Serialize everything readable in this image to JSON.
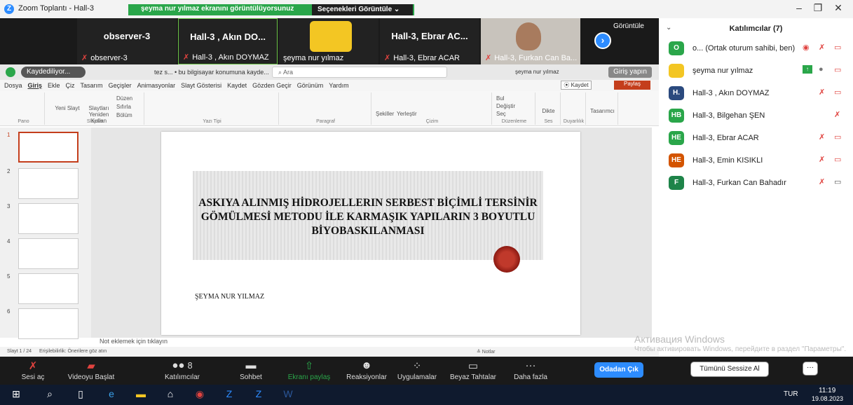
{
  "window": {
    "title": "Zoom Toplantı - Hall-3",
    "minimize": "–",
    "maximize": "❐",
    "close": "✕"
  },
  "share_banner": {
    "message": "şeyma nur yılmaz ekranını görüntülüyorsunuz",
    "options": "Seçenekleri Görüntüle  ⌄"
  },
  "strip": {
    "view_label": "Görüntüle",
    "tiles": [
      {
        "name": "observer-3",
        "tag": "observer-3"
      },
      {
        "name": "Hall-3 , Akın DO...",
        "tag": "Hall-3 , Akın DOYMAZ"
      },
      {
        "name": "",
        "tag": "şeyma nur yılmaz"
      },
      {
        "name": "Hall-3, Ebrar AC...",
        "tag": "Hall-3, Ebrar ACAR"
      },
      {
        "name": "",
        "tag": "Hall-3, Furkan Can Ba..."
      }
    ]
  },
  "ppt": {
    "recording": "Kaydediliyor...",
    "file": "tez s... • bu bilgisayar konumuna kayde...",
    "search": "Ara",
    "user": "şeyma nur yılmaz",
    "signin": "Giriş yapın",
    "menu": [
      "Dosya",
      "Giriş",
      "Ekle",
      "Çiz",
      "Tasarım",
      "Geçişler",
      "Animasyonlar",
      "Slayt Gösterisi",
      "Kaydet",
      "Gözden Geçir",
      "Görünüm",
      "Yardım"
    ],
    "save_btn": "⦿ Kaydet",
    "share_btn": "Paylaş",
    "ribbon_groups": [
      "Pano",
      "Slaytlar",
      "Yazı Tipi",
      "Paragraf",
      "Çizim",
      "Düzenleme",
      "Ses",
      "Duyarlılık",
      "Tasarımcı"
    ],
    "ribbon_items": {
      "new_slide": "Yeni Slayt",
      "reuse": "Slaytları Yeniden Kullan",
      "layout": "Düzen",
      "reset": "Sıfırla",
      "section": "Bölüm",
      "shapes": "Şekiller",
      "arrange": "Yerleştir",
      "find": "Bul",
      "replace": "Değiştir",
      "select": "Seç",
      "dictate": "Dikte",
      "designer": "Tasarımcı"
    },
    "slide_numbers": [
      "1",
      "2",
      "3",
      "4",
      "5",
      "6"
    ],
    "slide_title": "ASKIYA ALINMIŞ HİDROJELLERIN SERBEST BİÇİMLİ TERSİNİR GÖMÜLMESİ METODU İLE KARMAŞIK YAPILARIN 3 BOYUTLU BİYOBASKILANMASI",
    "slide_author": "ŞEYMA NUR YILMAZ",
    "notes_placeholder": "Not eklemek için tıklayın",
    "status": "Slayt 1 / 24",
    "accessibility": "Erişilebilirlik: Önerilere göz atın",
    "notes_btn": "≙ Notlar"
  },
  "panel": {
    "title": "Katılımcılar (7)",
    "participants": [
      {
        "initials": "O",
        "color": "#2aa64a",
        "name": "o... (Ortak oturum sahibi, ben)"
      },
      {
        "initials": "",
        "color": "#f3c623",
        "name": "şeyma nur yılmaz"
      },
      {
        "initials": "H.",
        "color": "#2b4a7e",
        "name": "Hall-3 , Akın DOYMAZ"
      },
      {
        "initials": "HB",
        "color": "#2aa64a",
        "name": "Hall-3, Bilgehan ŞEN"
      },
      {
        "initials": "HE",
        "color": "#2aa64a",
        "name": "Hall-3, Ebrar ACAR"
      },
      {
        "initials": "HE",
        "color": "#d35400",
        "name": "Hall-3, Emin KISIKLI"
      },
      {
        "initials": "F",
        "color": "#1e8449",
        "name": "Hall-3, Furkan Can Bahadır"
      }
    ],
    "watermark": "Активация Windows",
    "watermark2": "Чтобы активировать Windows, перейдите в раздел \"Параметры\"."
  },
  "toolbar": {
    "items": [
      "Sesi aç",
      "Videoyu Başlat",
      "Katılımcılar",
      "Sohbet",
      "Ekranı paylaş",
      "Reaksiyonlar",
      "Uygulamalar",
      "Beyaz Tahtalar",
      "Daha fazla"
    ],
    "participant_count": "8",
    "end": "Odadan Çık",
    "mute_all": "Tümünü Sessize Al",
    "more": "···"
  },
  "taskbar": {
    "lang": "TUR",
    "time": "11:19",
    "date": "19.08.2023"
  }
}
